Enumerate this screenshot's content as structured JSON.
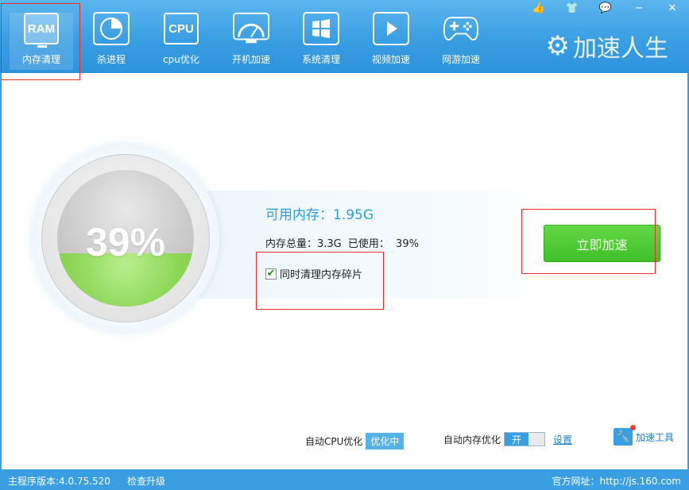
{
  "toolbar": {
    "items": [
      {
        "icon_text": "RAM",
        "label": "内存清理"
      },
      {
        "icon_text": "",
        "label": "杀进程"
      },
      {
        "icon_text": "CPU",
        "label": "cpu优化"
      },
      {
        "icon_text": "",
        "label": "开机加速"
      },
      {
        "icon_text": "",
        "label": "系统清理"
      },
      {
        "icon_text": "",
        "label": "视频加速"
      },
      {
        "icon_text": "",
        "label": "网游加速"
      }
    ]
  },
  "window_controls": {
    "like": "👍",
    "skin": "👕",
    "feedback": "💬",
    "minimize": "−",
    "close": "✕"
  },
  "brand": {
    "name": "加速人生"
  },
  "memory": {
    "percent_text": "39%",
    "percent": 39,
    "available_label": "可用内存：1.95G",
    "total_label": "内存总量：3.3G",
    "used_label": "已使用：",
    "used_value": "39%",
    "defrag_label": "同时清理内存碎片",
    "defrag_checked": true
  },
  "action": {
    "boost_label": "立即加速"
  },
  "options": {
    "auto_cpu_label": "自动CPU优化",
    "auto_cpu_state": "优化中",
    "auto_mem_label": "自动内存优化",
    "auto_mem_state": "开",
    "settings_link": "设置",
    "tools_label": "加速工具"
  },
  "status": {
    "version": "主程序版本:4.0.75.520",
    "check_update": "检查升级",
    "website": "官方网址：http://js.160.com"
  },
  "colors": {
    "accent": "#3a9ee3",
    "green": "#4ccf30",
    "highlight_box": "#e03030"
  }
}
